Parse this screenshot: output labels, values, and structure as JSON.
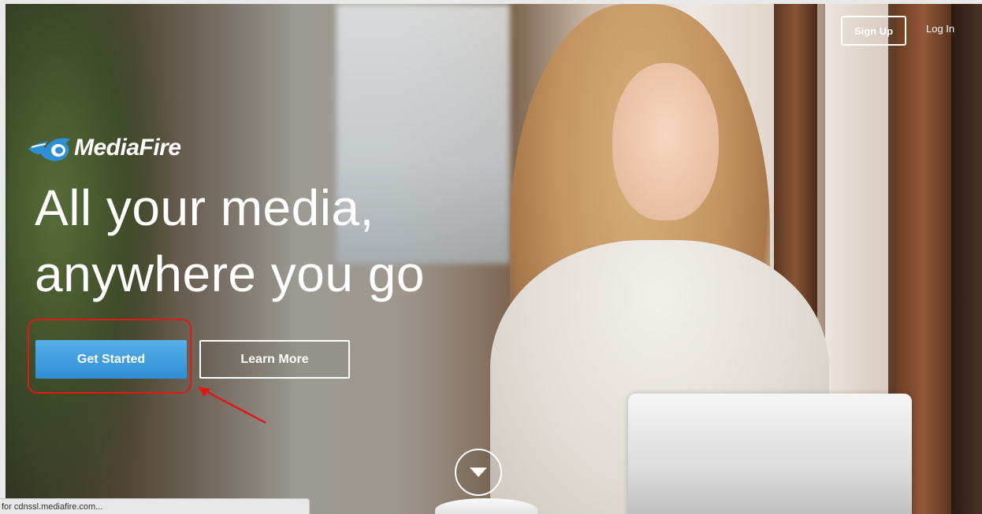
{
  "header": {
    "signup_label": "Sign Up",
    "login_label": "Log In"
  },
  "brand": {
    "logo_text": "MediaFire",
    "logo_color": "#2f8fd4"
  },
  "hero": {
    "headline_line1": "All your media,",
    "headline_line2": "anywhere you go",
    "get_started_label": "Get Started",
    "learn_more_label": "Learn More",
    "scroll_icon": "chevron-down-icon"
  },
  "annotation": {
    "highlight_color": "#e01818"
  },
  "status_bar": {
    "text": "for cdnssl.mediafire.com..."
  }
}
